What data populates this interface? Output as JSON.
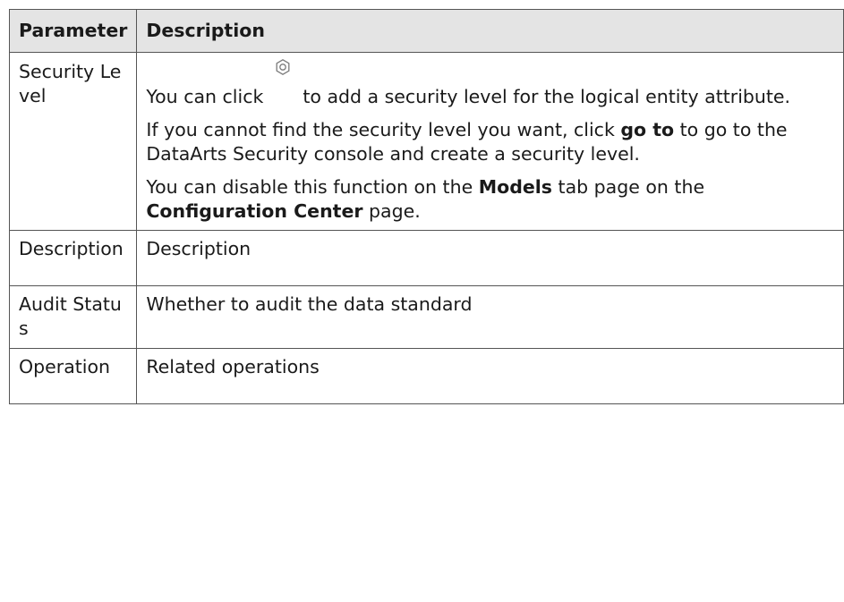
{
  "table": {
    "headers": {
      "parameter": "Parameter",
      "description": "Description"
    },
    "security_level": {
      "parameter": "Security Level",
      "p1_before": "You can click",
      "p1_icon": "gear-icon",
      "p1_after": "to add a security level for the logical entity attribute.",
      "p2_before": "If you cannot find the security level you want, click ",
      "p2_bold": "go to",
      "p2_after": " to go to the DataArts Security console and create a security level.",
      "p3_before": "You can disable this function on the ",
      "p3_bold1": "Models",
      "p3_mid": " tab page on the ",
      "p3_bold2": "Configuration Center",
      "p3_after": " page."
    },
    "rows": [
      {
        "parameter": "Description",
        "description": "Description"
      },
      {
        "parameter": "Audit Status",
        "description": "Whether to audit the data standard"
      },
      {
        "parameter": "Operation",
        "description": "Related operations"
      }
    ]
  }
}
